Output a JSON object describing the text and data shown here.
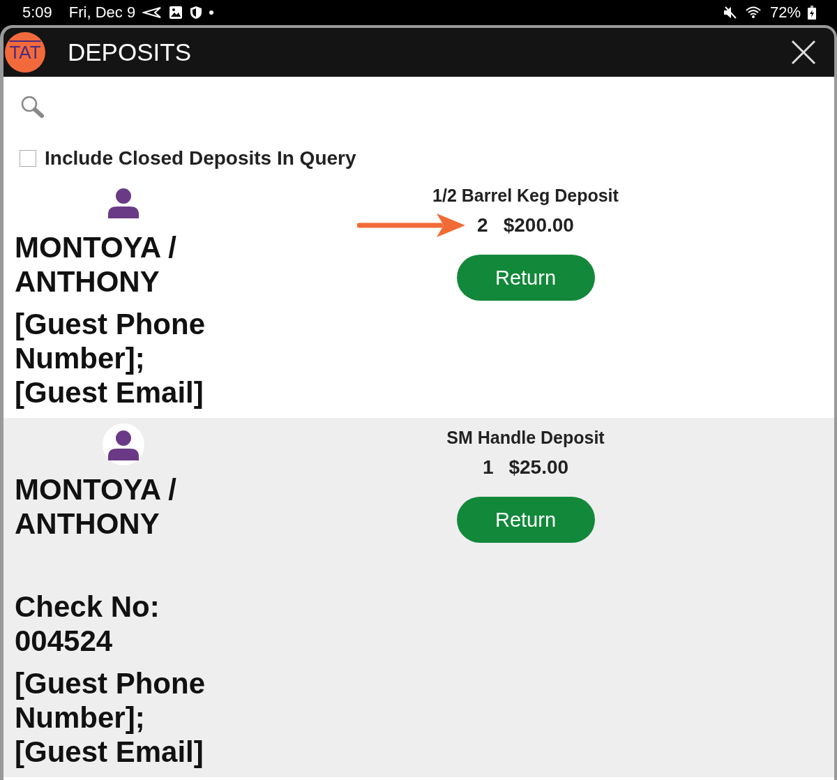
{
  "status_bar": {
    "time": "5:09",
    "date": "Fri, Dec 9",
    "battery": "72%"
  },
  "window": {
    "title": "DEPOSITS",
    "logo": "TAT"
  },
  "filter": {
    "label": "Include Closed Deposits In Query",
    "checked": false
  },
  "deposits": [
    {
      "guest": "MONTOYA / ANTHONY",
      "contact": "[Guest Phone Number]; [Guest Email]",
      "item": "1/2 Barrel Keg Deposit",
      "quantity": "2",
      "amount": "$200.00",
      "action": "Return",
      "highlighted": true
    },
    {
      "guest": "MONTOYA / ANTHONY",
      "check": "Check No: 004524",
      "contact": "[Guest Phone Number]; [Guest Email]",
      "item": "SM Handle Deposit",
      "quantity": "1",
      "amount": "$25.00",
      "action": "Return",
      "highlighted": false
    }
  ]
}
